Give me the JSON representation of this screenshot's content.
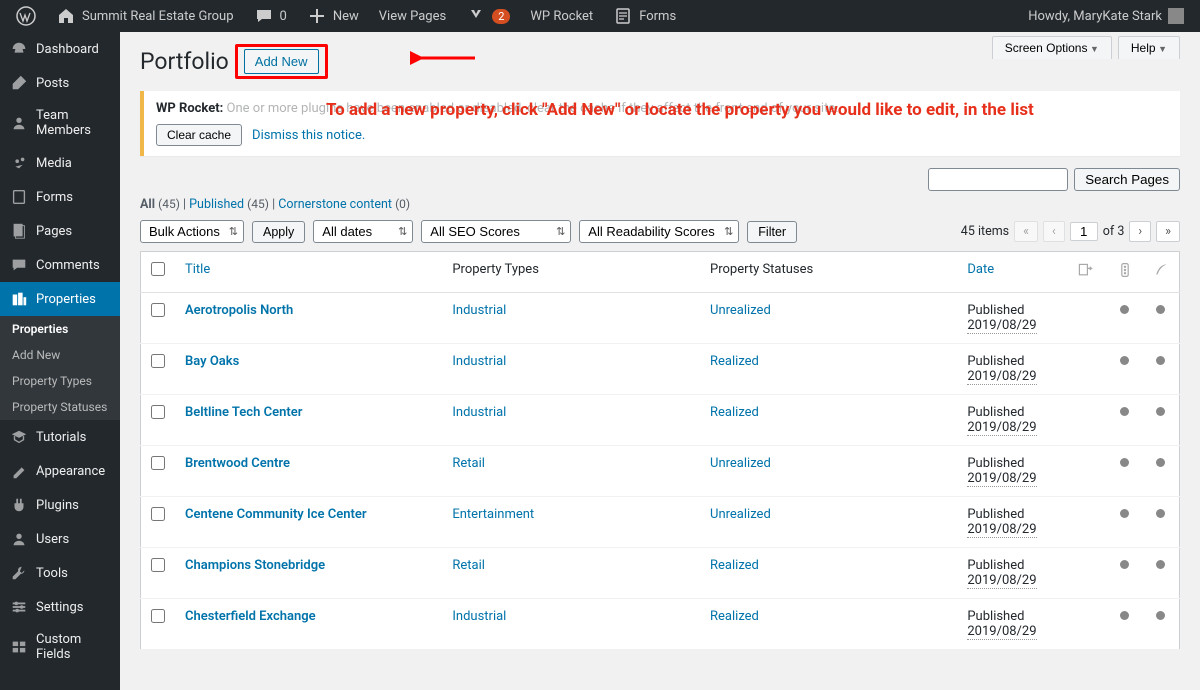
{
  "adminbar": {
    "site": "Summit Real Estate Group",
    "comments": "0",
    "new": "New",
    "viewPages": "View Pages",
    "yoastBadge": "2",
    "wpRocket": "WP Rocket",
    "forms": "Forms",
    "howdy": "Howdy, MaryKate Stark"
  },
  "sidebar": {
    "items": [
      {
        "label": "Dashboard"
      },
      {
        "label": "Posts"
      },
      {
        "label": "Team Members"
      },
      {
        "label": "Media"
      },
      {
        "label": "Forms"
      },
      {
        "label": "Pages"
      },
      {
        "label": "Comments"
      },
      {
        "label": "Properties",
        "current": true
      },
      {
        "label": "Tutorials"
      },
      {
        "label": "Appearance"
      },
      {
        "label": "Plugins"
      },
      {
        "label": "Users"
      },
      {
        "label": "Tools"
      },
      {
        "label": "Settings"
      },
      {
        "label": "Custom Fields"
      }
    ],
    "submenu": [
      {
        "label": "Properties",
        "current": true
      },
      {
        "label": "Add New"
      },
      {
        "label": "Property Types"
      },
      {
        "label": "Property Statuses"
      }
    ]
  },
  "header": {
    "title": "Portfolio",
    "addNew": "Add New",
    "instruction": "To add a new property, click \"Add New\" or locate the property you would like to edit, in the list",
    "screenOptions": "Screen Options",
    "help": "Help"
  },
  "notice": {
    "strong": "WP Rocket:",
    "text": " One or more plugins have been enabled or disabled, clear the cache if they affect the front end of your site.",
    "clearBtn": "Clear cache",
    "dismiss": "Dismiss this notice."
  },
  "views": {
    "allLabel": "All",
    "allCount": "(45)",
    "publishedLabel": "Published",
    "publishedCount": "(45)",
    "cornerstoneLabel": "Cornerstone content",
    "cornerstoneCount": "(0)"
  },
  "filters": {
    "bulk": "Bulk Actions",
    "apply": "Apply",
    "dates": "All dates",
    "seo": "All SEO Scores",
    "readability": "All Readability Scores",
    "filter": "Filter"
  },
  "search": {
    "button": "Search Pages"
  },
  "pagination": {
    "items": "45 items",
    "current": "1",
    "of": "of 3"
  },
  "table": {
    "cols": {
      "title": "Title",
      "type": "Property Types",
      "status": "Property Statuses",
      "date": "Date"
    },
    "rows": [
      {
        "title": "Aerotropolis North",
        "type": "Industrial",
        "status": "Unrealized",
        "pub": "Published",
        "date": "2019/08/29"
      },
      {
        "title": "Bay Oaks",
        "type": "Industrial",
        "status": "Realized",
        "pub": "Published",
        "date": "2019/08/29"
      },
      {
        "title": "Beltline Tech Center",
        "type": "Industrial",
        "status": "Realized",
        "pub": "Published",
        "date": "2019/08/29"
      },
      {
        "title": "Brentwood Centre",
        "type": "Retail",
        "status": "Unrealized",
        "pub": "Published",
        "date": "2019/08/29"
      },
      {
        "title": "Centene Community Ice Center",
        "type": "Entertainment",
        "status": "Unrealized",
        "pub": "Published",
        "date": "2019/08/29"
      },
      {
        "title": "Champions Stonebridge",
        "type": "Retail",
        "status": "Realized",
        "pub": "Published",
        "date": "2019/08/29"
      },
      {
        "title": "Chesterfield Exchange",
        "type": "Industrial",
        "status": "Realized",
        "pub": "Published",
        "date": "2019/08/29"
      }
    ]
  }
}
